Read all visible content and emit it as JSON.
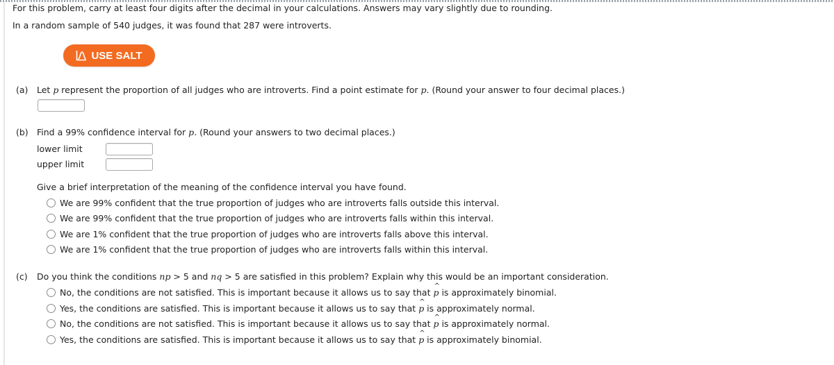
{
  "instructions": "For this problem, carry at least four digits after the decimal in your calculations. Answers may vary slightly due to rounding.",
  "problem": "In a random sample of 540 judges, it was found that 287 were introverts.",
  "salt_button": {
    "label": "USE SALT",
    "icon": "distribution-curve-icon",
    "color": "#f26b21"
  },
  "part_a": {
    "label": "(a)",
    "text_before": "Let ",
    "variable": "p",
    "text_middle": " represent the proportion of all judges who are introverts. Find a point estimate for ",
    "text_after": ". (Round your answer to four decimal places.)",
    "answer_value": ""
  },
  "part_b": {
    "label": "(b)",
    "text_before": "Find a 99% confidence interval for ",
    "variable": "p",
    "text_after": ". (Round your answers to two decimal places.)",
    "lower_label": "lower limit",
    "lower_value": "",
    "upper_label": "upper limit",
    "upper_value": "",
    "interpretation_prompt": "Give a brief interpretation of the meaning of the confidence interval you have found.",
    "options": [
      "We are 99% confident that the true proportion of judges who are introverts falls outside this interval.",
      "We are 99% confident that the true proportion of judges who are introverts falls within this interval.",
      "We are 1% confident that the true proportion of judges who are introverts falls above this interval.",
      "We are 1% confident that the true proportion of judges who are introverts falls within this interval."
    ]
  },
  "part_c": {
    "label": "(c)",
    "q_1": "Do you think the conditions ",
    "np": "np",
    "q_2": " > 5 and ",
    "nq": "nq",
    "q_3": " > 5 are satisfied in this problem? Explain why this would be an important consideration.",
    "phat": "p",
    "options": [
      {
        "before": "No, the conditions are not satisfied. This is important because it allows us to say that ",
        "after": " is approximately binomial."
      },
      {
        "before": "Yes, the conditions are satisfied. This is important because it allows us to say that ",
        "after": " is approximately normal."
      },
      {
        "before": "No, the conditions are not satisfied. This is important because it allows us to say that ",
        "after": " is approximately normal."
      },
      {
        "before": "Yes, the conditions are satisfied. This is important because it allows us to say that ",
        "after": " is approximately binomial."
      }
    ]
  }
}
